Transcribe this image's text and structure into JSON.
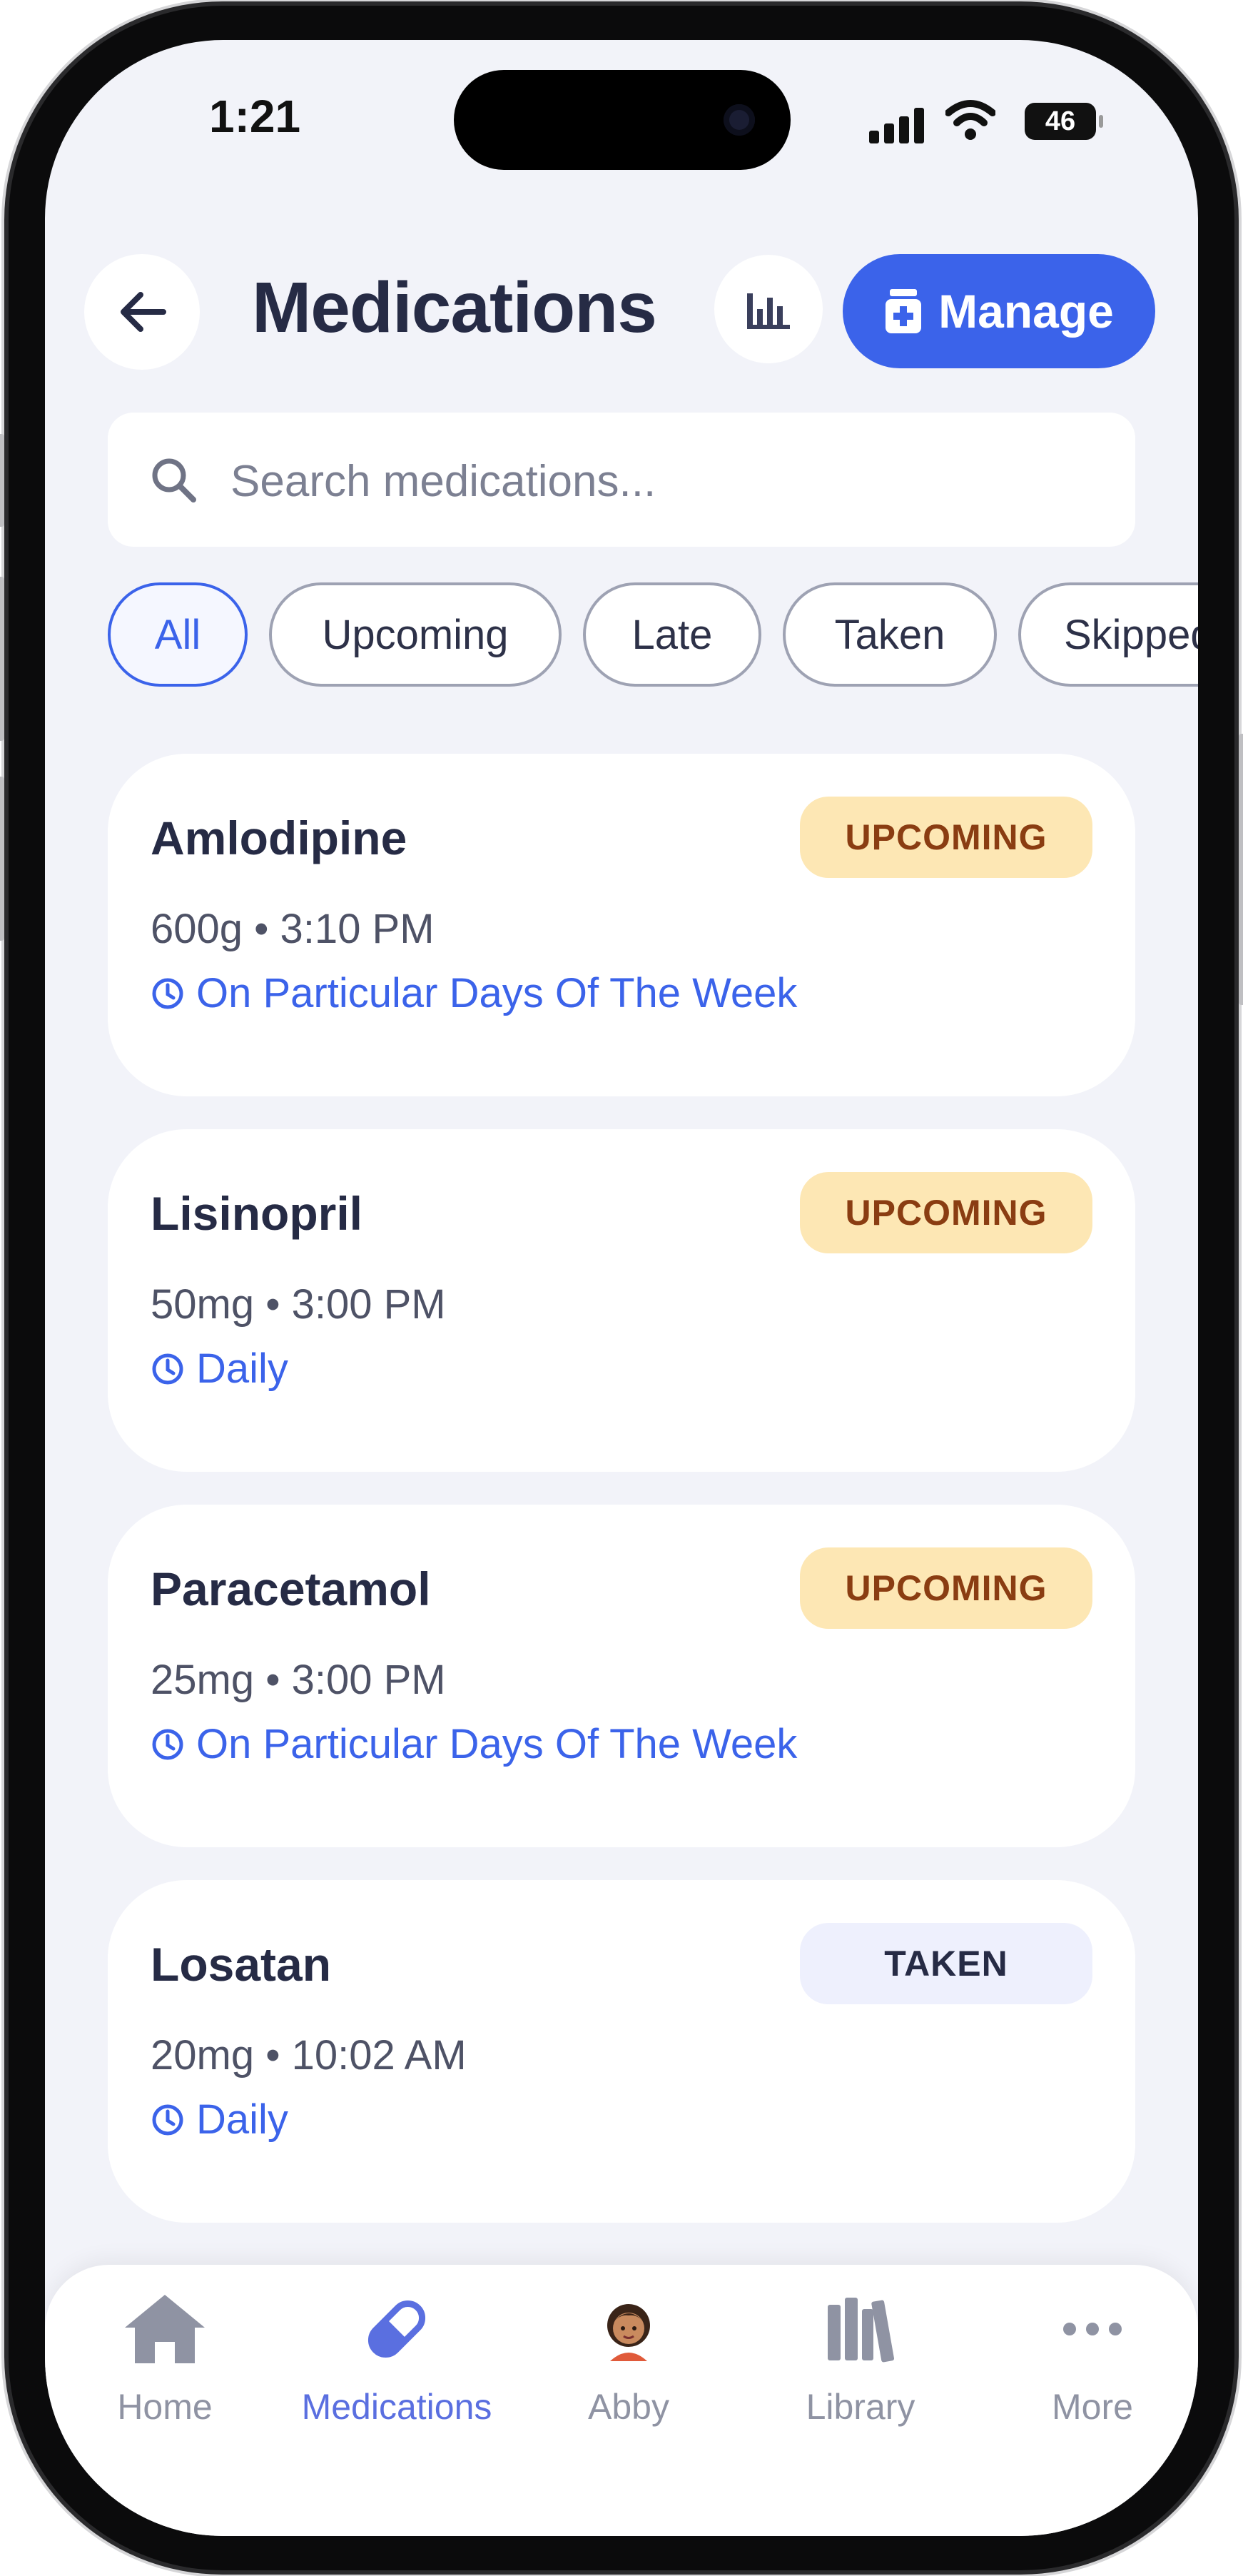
{
  "status_bar": {
    "time": "1:21",
    "battery": "46"
  },
  "header": {
    "title": "Medications",
    "manage_label": "Manage"
  },
  "search": {
    "placeholder": "Search medications..."
  },
  "filters": [
    "All",
    "Upcoming",
    "Late",
    "Taken",
    "Skipped"
  ],
  "active_filter": "All",
  "medications": [
    {
      "name": "Amlodipine",
      "dose_time": "600g • 3:10 PM",
      "schedule": "On Particular Days Of The Week",
      "status": "UPCOMING"
    },
    {
      "name": "Lisinopril",
      "dose_time": "50mg • 3:00 PM",
      "schedule": "Daily",
      "status": "UPCOMING"
    },
    {
      "name": "Paracetamol",
      "dose_time": "25mg • 3:00 PM",
      "schedule": "On Particular Days Of The Week",
      "status": "UPCOMING"
    },
    {
      "name": "Losatan",
      "dose_time": "20mg • 10:02 AM",
      "schedule": "Daily",
      "status": "TAKEN"
    }
  ],
  "nav": [
    {
      "label": "Home",
      "icon": "home-icon"
    },
    {
      "label": "Medications",
      "icon": "pill-icon"
    },
    {
      "label": "Abby",
      "icon": "avatar-icon"
    },
    {
      "label": "Library",
      "icon": "library-icon"
    },
    {
      "label": "More",
      "icon": "more-icon"
    }
  ],
  "active_nav": "Medications",
  "colors": {
    "accent": "#3b63ea",
    "upcoming_bg": "#fde7b4",
    "upcoming_text": "#8a3d12",
    "taken_bg": "#eef0fd",
    "background": "#f2f3f9"
  }
}
